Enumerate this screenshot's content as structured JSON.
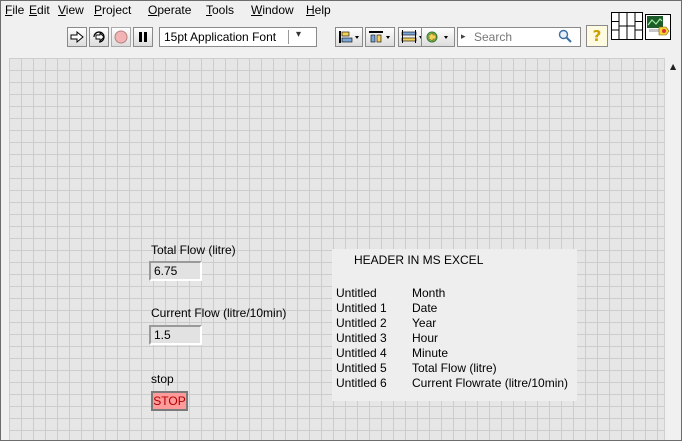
{
  "menu": {
    "items": [
      {
        "mnemonic": "F",
        "rest": "ile"
      },
      {
        "mnemonic": "E",
        "rest": "dit"
      },
      {
        "mnemonic": "V",
        "rest": "iew"
      },
      {
        "mnemonic": "P",
        "rest": "roject"
      },
      {
        "mnemonic": "O",
        "rest": "perate"
      },
      {
        "mnemonic": "T",
        "rest": "ools"
      },
      {
        "mnemonic": "W",
        "rest": "indow"
      },
      {
        "mnemonic": "H",
        "rest": "elp"
      }
    ]
  },
  "toolbar": {
    "font_select_value": "15pt Application Font",
    "search_placeholder": "Search"
  },
  "icons": {
    "run": "run-arrow-icon",
    "run_continuous": "run-continuously-icon",
    "abort": "abort-icon",
    "pause": "pause-icon",
    "align": "align-objects-icon",
    "distribute": "distribute-objects-icon",
    "resize": "resize-objects-icon",
    "reorder": "reorder-icon",
    "search": "search-icon",
    "help": "help-icon"
  },
  "panel": {
    "total_flow_label": "Total Flow (litre)",
    "total_flow_value": "6.75",
    "current_flow_label": "Current Flow (litre/10min)",
    "current_flow_value": "1.5",
    "stop_label": "stop",
    "stop_button_text": "STOP"
  },
  "header_table": {
    "title": "HEADER IN MS EXCEL",
    "rows": [
      {
        "name": "Untitled",
        "value": "Month"
      },
      {
        "name": "Untitled 1",
        "value": "Date"
      },
      {
        "name": "Untitled 2",
        "value": "Year"
      },
      {
        "name": "Untitled 3",
        "value": "Hour"
      },
      {
        "name": "Untitled 4",
        "value": "Minute"
      },
      {
        "name": "Untitled 5",
        "value": "Total Flow (litre)"
      },
      {
        "name": "Untitled 6",
        "value": "Current Flowrate (litre/10min)"
      }
    ]
  },
  "colors": {
    "stop_button_bg": "#ff9a9a",
    "stop_button_text": "#b00000",
    "panel_grid_bg": "#e6e6e6"
  }
}
